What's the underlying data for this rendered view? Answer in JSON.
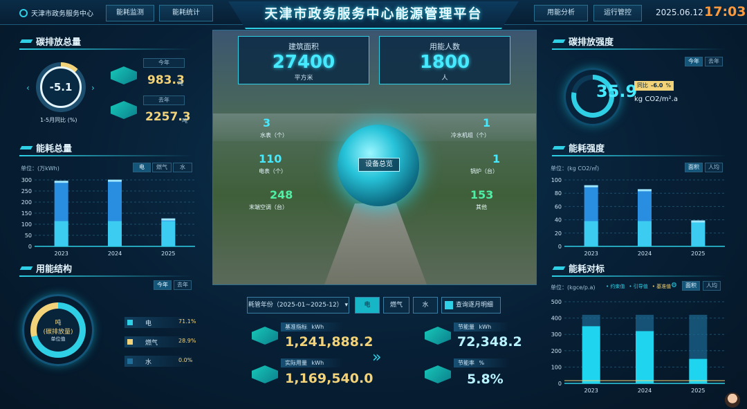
{
  "header": {
    "logo": "天津市政务服务中心",
    "title": "天津市政务服务中心能源管理平台",
    "nav": [
      "能耗监测",
      "能耗统计",
      "用能分析",
      "运行管控"
    ],
    "date": "2025.06.12",
    "time": "17:03"
  },
  "carbon_total": {
    "title": "碳排放总量",
    "ratio": "-5.1",
    "ratio_label": "1-5月同比",
    "ratio_unit": "(%)",
    "this_year_label": "今年",
    "this_year_value": "983.3",
    "last_year_label": "去年",
    "last_year_value": "2257.3",
    "unit": "吨"
  },
  "energy_total": {
    "title": "能耗总量",
    "unit": "单位：(万kWh)",
    "tabs": [
      "电",
      "燃气",
      "水"
    ],
    "yticks": [
      "300",
      "250",
      "200",
      "150",
      "100",
      "50",
      "0"
    ],
    "chart_data": {
      "type": "bar",
      "categories": [
        "2023",
        "2024",
        "2025"
      ],
      "values": [
        290,
        295,
        120
      ],
      "ylim": [
        0,
        300
      ]
    }
  },
  "energy_structure": {
    "title": "用能结构",
    "tabs": [
      "今年",
      "去年"
    ],
    "center_unit": "吨",
    "center_label": "(碳排放量)",
    "center_sub": "单位值",
    "items": [
      {
        "label": "电",
        "pct": "71.1%"
      },
      {
        "label": "燃气",
        "pct": "28.9%"
      },
      {
        "label": "水",
        "pct": "0.0%"
      }
    ],
    "colors": {
      "elec": "#2fd0e6",
      "gas": "#f2d37a",
      "water": "#1f6f9a"
    }
  },
  "center": {
    "area_label": "建筑面积",
    "area_value": "27400",
    "area_unit": "平方米",
    "people_label": "用能人数",
    "people_value": "1800",
    "people_unit": "人",
    "globe_btn": "设备总览",
    "left": [
      {
        "num": "3",
        "label": "水表（个）"
      },
      {
        "num": "110",
        "label": "电表（个）"
      },
      {
        "num": "248",
        "label": "末端空调（台）"
      }
    ],
    "right": [
      {
        "num": "1",
        "label": "冷水机组（个）"
      },
      {
        "num": "1",
        "label": "锅炉（台）"
      },
      {
        "num": "153",
        "label": "其他"
      }
    ]
  },
  "query": {
    "year_select": "耗管年份（2025-01~2025-12）",
    "tabs": [
      "电",
      "燃气",
      "水"
    ],
    "btn": "查询逐月明细",
    "base_label": "基准指标",
    "base_unit": "kWh",
    "base_value": "1,241,888.2",
    "actual_label": "实际用量",
    "actual_unit": "kWh",
    "actual_value": "1,169,540.0",
    "save_label": "节能量",
    "save_unit": "kWh",
    "save_value": "72,348.2",
    "rate_label": "节能率",
    "rate_unit": "%",
    "rate_value": "5.8%"
  },
  "carbon_intensity": {
    "title": "碳排放强度",
    "tabs": [
      "今年",
      "去年"
    ],
    "value": "35.9",
    "unit": "kg CO2/m².a",
    "yoy_label": "同比",
    "yoy_value": "-6.0",
    "yoy_unit": "%"
  },
  "energy_intensity": {
    "title": "能耗强度",
    "unit": "单位：(kg CO2/㎡)",
    "tabs": [
      "面积",
      "人均"
    ],
    "yticks": [
      "100",
      "80",
      "60",
      "40",
      "20",
      "0"
    ],
    "chart_data": {
      "type": "bar",
      "categories": [
        "2023",
        "2024",
        "2025"
      ],
      "values": [
        90,
        84,
        37
      ],
      "ylim": [
        0,
        100
      ]
    }
  },
  "energy_benchmark": {
    "title": "能耗对标",
    "unit": "单位：(kgce/p.a)",
    "legend": [
      "约束值",
      "引导值",
      "基准值"
    ],
    "tabs": [
      "面积",
      "人均"
    ],
    "yticks": [
      "500",
      "400",
      "300",
      "200",
      "100",
      "0"
    ],
    "chart_data": {
      "type": "bar",
      "categories": [
        "2023",
        "2024",
        "2025"
      ],
      "series": [
        {
          "name": "约束值",
          "values": [
            420,
            420,
            420
          ]
        },
        {
          "name": "引导值",
          "values": [
            350,
            320,
            150
          ]
        }
      ],
      "ylim": [
        0,
        500
      ]
    }
  }
}
